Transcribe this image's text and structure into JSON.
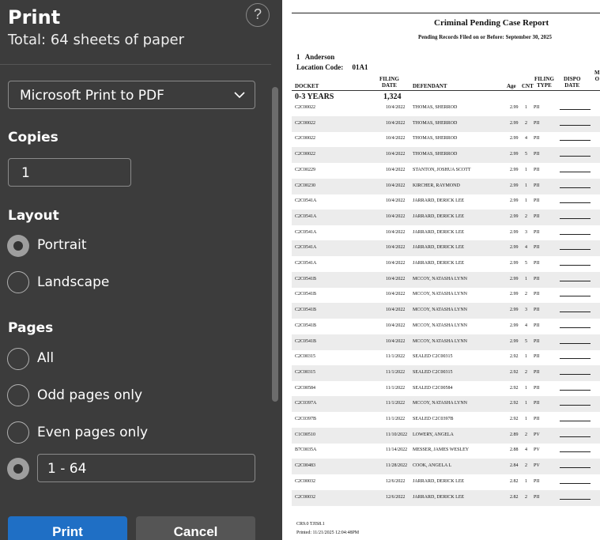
{
  "panel": {
    "title": "Print",
    "help_label": "?",
    "total_sheets": "Total: 64 sheets of paper",
    "printer": {
      "selected": "Microsoft Print to PDF"
    },
    "copies": {
      "label": "Copies",
      "value": "1"
    },
    "layout": {
      "label": "Layout",
      "options": [
        "Portrait",
        "Landscape"
      ],
      "selected": "Portrait"
    },
    "pages": {
      "label": "Pages",
      "options": [
        "All",
        "Odd pages only",
        "Even pages only"
      ],
      "range_value": "1 - 64",
      "selected": "range"
    },
    "print_button": "Print",
    "cancel_button": "Cancel"
  },
  "colors": {
    "panel_bg": "#3c3c3c",
    "primary_button": "#1f6fc5",
    "secondary_button": "#555555"
  },
  "preview": {
    "title": "Criminal Pending Case Report",
    "subtitle": "Pending Records Filed on or Before: September 30, 2025",
    "location_number": "1",
    "location_name": "Anderson",
    "location_code_label": "Location Code:",
    "location_code": "01A1",
    "headers": {
      "docket": "DOCKET",
      "filing_date": [
        "FILING",
        "DATE"
      ],
      "defendant": "DEFENDANT",
      "age": "Age",
      "cnt": "CNT",
      "filing_type": [
        "FILING",
        "TYPE"
      ],
      "dispo_date": [
        "DISPO",
        "DATE"
      ],
      "next": [
        "M",
        "O"
      ]
    },
    "group_label": "0-3 YEARS",
    "group_count": "1,324",
    "rows": [
      {
        "docket": "C2C00022",
        "date": "10/4/2022",
        "defendant": "THOMAS, SHERROD",
        "age": "2.99",
        "cnt": "1",
        "type": "PII"
      },
      {
        "docket": "C2C00022",
        "date": "10/4/2022",
        "defendant": "THOMAS, SHERROD",
        "age": "2.99",
        "cnt": "2",
        "type": "PII"
      },
      {
        "docket": "C2C00022",
        "date": "10/4/2022",
        "defendant": "THOMAS, SHERROD",
        "age": "2.99",
        "cnt": "4",
        "type": "PII"
      },
      {
        "docket": "C2C00022",
        "date": "10/4/2022",
        "defendant": "THOMAS, SHERROD",
        "age": "2.99",
        "cnt": "5",
        "type": "PII"
      },
      {
        "docket": "C2C00229",
        "date": "10/4/2022",
        "defendant": "STANTON, JOSHUA SCOTT",
        "age": "2.99",
        "cnt": "1",
        "type": "PII"
      },
      {
        "docket": "C2C00230",
        "date": "10/4/2022",
        "defendant": "KIRCHER, RAYMOND",
        "age": "2.99",
        "cnt": "1",
        "type": "PII"
      },
      {
        "docket": "C2C0541A",
        "date": "10/4/2022",
        "defendant": "JARRARD, DERICK LEE",
        "age": "2.99",
        "cnt": "1",
        "type": "PII"
      },
      {
        "docket": "C2C0541A",
        "date": "10/4/2022",
        "defendant": "JARRARD, DERICK LEE",
        "age": "2.99",
        "cnt": "2",
        "type": "PII"
      },
      {
        "docket": "C2C0541A",
        "date": "10/4/2022",
        "defendant": "JARRARD, DERICK LEE",
        "age": "2.99",
        "cnt": "3",
        "type": "PII"
      },
      {
        "docket": "C2C0541A",
        "date": "10/4/2022",
        "defendant": "JARRARD, DERICK LEE",
        "age": "2.99",
        "cnt": "4",
        "type": "PII"
      },
      {
        "docket": "C2C0541A",
        "date": "10/4/2022",
        "defendant": "JARRARD, DERICK LEE",
        "age": "2.99",
        "cnt": "5",
        "type": "PII"
      },
      {
        "docket": "C2C0541B",
        "date": "10/4/2022",
        "defendant": "MCCOY, NATASHA LYNN",
        "age": "2.99",
        "cnt": "1",
        "type": "PII"
      },
      {
        "docket": "C2C0541B",
        "date": "10/4/2022",
        "defendant": "MCCOY, NATASHA LYNN",
        "age": "2.99",
        "cnt": "2",
        "type": "PII"
      },
      {
        "docket": "C2C0541B",
        "date": "10/4/2022",
        "defendant": "MCCOY, NATASHA LYNN",
        "age": "2.99",
        "cnt": "3",
        "type": "PII"
      },
      {
        "docket": "C2C0541B",
        "date": "10/4/2022",
        "defendant": "MCCOY, NATASHA LYNN",
        "age": "2.99",
        "cnt": "4",
        "type": "PII"
      },
      {
        "docket": "C2C0541B",
        "date": "10/4/2022",
        "defendant": "MCCOY, NATASHA LYNN",
        "age": "2.99",
        "cnt": "5",
        "type": "PII"
      },
      {
        "docket": "C2C00315",
        "date": "11/1/2022",
        "defendant": "SEALED C2C00315",
        "age": "2.92",
        "cnt": "1",
        "type": "PII"
      },
      {
        "docket": "C2C00315",
        "date": "11/1/2022",
        "defendant": "SEALED C2C00315",
        "age": "2.92",
        "cnt": "2",
        "type": "PII"
      },
      {
        "docket": "C2C00584",
        "date": "11/1/2022",
        "defendant": "SEALED C2C00584",
        "age": "2.92",
        "cnt": "1",
        "type": "PII"
      },
      {
        "docket": "C2C0397A",
        "date": "11/1/2022",
        "defendant": "MCCOY, NATASHA LYNN",
        "age": "2.92",
        "cnt": "1",
        "type": "PII"
      },
      {
        "docket": "C2C0397B",
        "date": "11/1/2022",
        "defendant": "SEALED C2C0397B",
        "age": "2.92",
        "cnt": "1",
        "type": "PII"
      },
      {
        "docket": "C1C00510",
        "date": "11/10/2022",
        "defendant": "LOWERY, ANGELA",
        "age": "2.89",
        "cnt": "2",
        "type": "PV"
      },
      {
        "docket": "B7C0035A",
        "date": "11/14/2022",
        "defendant": "MESSER, JAMES WESLEY",
        "age": "2.88",
        "cnt": "4",
        "type": "PV"
      },
      {
        "docket": "C2C00483",
        "date": "11/28/2022",
        "defendant": "COOK, ANGELA L",
        "age": "2.84",
        "cnt": "2",
        "type": "PV"
      },
      {
        "docket": "C2C00032",
        "date": "12/6/2022",
        "defendant": "JARRARD, DERICK LEE",
        "age": "2.82",
        "cnt": "1",
        "type": "PII"
      },
      {
        "docket": "C2C00032",
        "date": "12/6/2022",
        "defendant": "JARRARD, DERICK LEE",
        "age": "2.82",
        "cnt": "2",
        "type": "PII"
      }
    ],
    "footer_line1": "CR9.0 TJIS8.1",
    "footer_line2": "Printed: 11/21/2025 12:04:48PM"
  }
}
